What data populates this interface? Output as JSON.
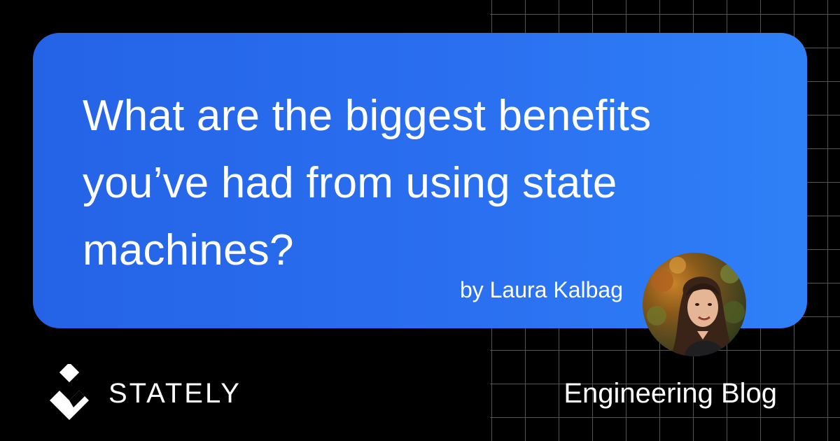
{
  "post": {
    "title": "What are the biggest benefits\nyou’ve had from using state\nmachines?",
    "author": "by Laura Kalbag"
  },
  "brand": {
    "name": "STATELY",
    "logo_icon": "stately-logo-icon"
  },
  "section": "Engineering Blog",
  "colors": {
    "background": "#000000",
    "card_start": "#2563e6",
    "card_end": "#2f80f7",
    "text": "#ffffff",
    "grid": "#555555"
  }
}
